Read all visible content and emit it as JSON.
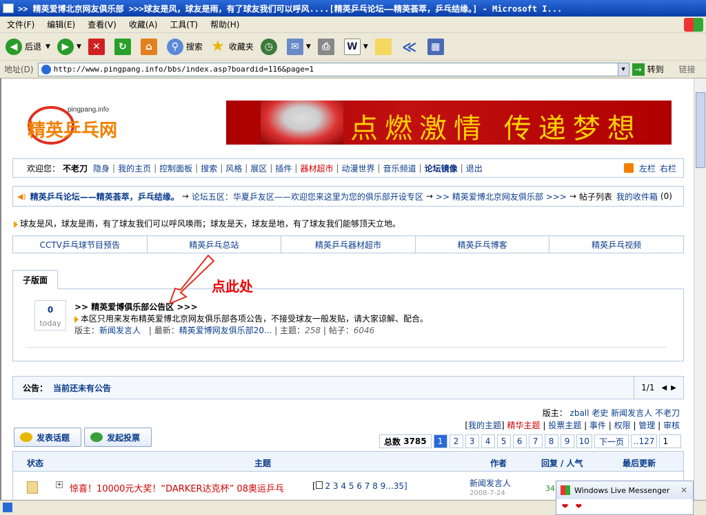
{
  "window": {
    "title": ">> 精英爱博北京网友俱乐部 >>>球友是风，球友是雨，有了球友我们可以呼风....[精英乒乓论坛——精英荟萃，乒乓结缘。] - Microsoft I..."
  },
  "menu": [
    "文件(F)",
    "编辑(E)",
    "查看(V)",
    "收藏(A)",
    "工具(T)",
    "帮助(H)"
  ],
  "toolbar": {
    "back": "后退",
    "search": "搜索",
    "favorites": "收藏夹"
  },
  "address": {
    "label": "地址(D)",
    "url": "http://www.pingpang.info/bbs/index.asp?boardid=116&page=1",
    "go": "转到",
    "links": "链接"
  },
  "logo": {
    "domain": "pingpang.info",
    "text": "精英乒乓网"
  },
  "banner": {
    "text": "点燃激情 传递梦想"
  },
  "userbar": {
    "welcome": "欢迎您：",
    "user": "不老刀",
    "links": [
      "隐身",
      "我的主页",
      "控制面板",
      "搜索",
      "风格",
      "展区",
      "插件",
      "器材超市",
      "动漫世界",
      "音乐频道",
      "论坛镜像",
      "退出"
    ],
    "right": [
      "左栏",
      "右栏"
    ]
  },
  "nav": {
    "forum": "精英乒乓论坛——精英荟萃，乒乓结缘。",
    "arrow": "→",
    "section": "论坛五区：华夏乒友区——欢迎您来这里为您的俱乐部开设专区",
    "club": ">> 精英爱博北京网友俱乐部 >>>",
    "list": "帖子列表",
    "inbox": "我的收件箱",
    "count": "(0)"
  },
  "motto": "球友是风，球友是雨，有了球友我们可以呼风唤雨；球友是天，球友是地，有了球友我们能够顶天立地。",
  "quicklinks": [
    "CCTV乒乓球节目预告",
    "精英乒乓总站",
    "精英乒乓器材超市",
    "精英乒乓博客",
    "精英乒乓视频"
  ],
  "subforum": {
    "tab": "子版面",
    "today_count": "0",
    "today_label": "today",
    "name": ">> 精英爱博俱乐部公告区 >>>",
    "desc": "本区只用来发布精英爱博北京网友俱乐部各项公告，不接受球友一般发贴，请大家谅解、配合。",
    "mod_label": "版主：",
    "mod": "新闻发言人",
    "latest_label": "| 最新：",
    "latest": "精英爱博网友俱乐部20...",
    "topics_label": "| 主题：",
    "topics": "258",
    "posts_label": "| 帖子：",
    "posts": "6046"
  },
  "annotation": "点此处",
  "notice": {
    "label": "公告：",
    "text": "当前还未有公告",
    "page": "1/1"
  },
  "moderators": {
    "label": "版主：",
    "names": [
      "zball",
      "老史",
      "新闻发言人",
      "不老刀"
    ]
  },
  "modlinks": [
    "我的主题",
    "精华主题",
    "投票主题",
    "事件",
    "权限",
    "管理",
    "审核"
  ],
  "buttons": {
    "post": "发表话题",
    "vote": "发起投票"
  },
  "pagination": {
    "total_label": "总数",
    "total": "3785",
    "pages": [
      "1",
      "2",
      "3",
      "4",
      "5",
      "6",
      "7",
      "8",
      "9",
      "10"
    ],
    "next": "下一页",
    "last": "..127",
    "input": "1"
  },
  "table": {
    "status": "状态",
    "topic": "主题",
    "author": "作者",
    "replies": "回复",
    "views": "/ 人气",
    "updated": "最后更新"
  },
  "row1": {
    "title": "惊喜！10000元大奖！“DARKER达克杯” 08奥运乒乓",
    "pages": "2 3 4 5 6 7 8 9...35]",
    "author": "新闻发言人",
    "date": "2008-7-24",
    "replies": "345"
  },
  "messenger": {
    "title": "Windows Live Messenger"
  }
}
